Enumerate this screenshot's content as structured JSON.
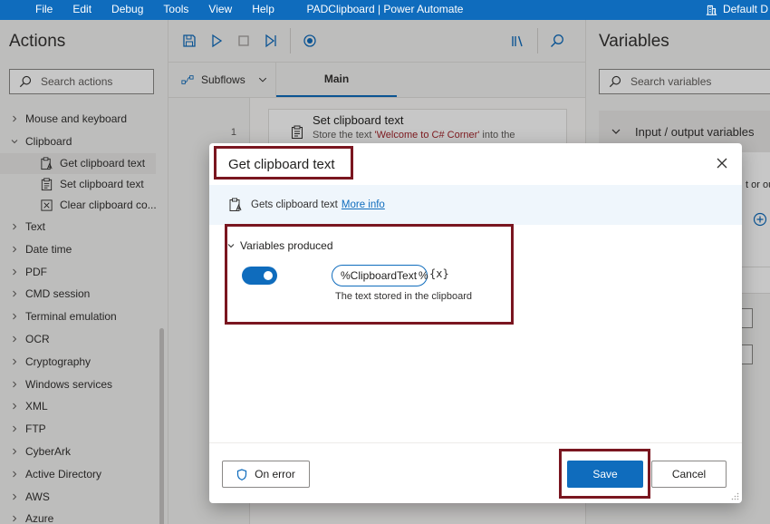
{
  "window": {
    "title": "PADClipboard | Power Automate",
    "menu": [
      "File",
      "Edit",
      "Debug",
      "Tools",
      "View",
      "Help"
    ],
    "profile": "Default D"
  },
  "actions_pane": {
    "title": "Actions",
    "search_placeholder": "Search actions",
    "groups": [
      {
        "label": "Mouse and keyboard",
        "expanded": false
      },
      {
        "label": "Clipboard",
        "expanded": true,
        "children": [
          "Get clipboard text",
          "Set clipboard text",
          "Clear clipboard co..."
        ]
      },
      {
        "label": "Text",
        "expanded": false
      },
      {
        "label": "Date time",
        "expanded": false
      },
      {
        "label": "PDF",
        "expanded": false
      },
      {
        "label": "CMD session",
        "expanded": false
      },
      {
        "label": "Terminal emulation",
        "expanded": false
      },
      {
        "label": "OCR",
        "expanded": false
      },
      {
        "label": "Cryptography",
        "expanded": false
      },
      {
        "label": "Windows services",
        "expanded": false
      },
      {
        "label": "XML",
        "expanded": false
      },
      {
        "label": "FTP",
        "expanded": false
      },
      {
        "label": "CyberArk",
        "expanded": false
      },
      {
        "label": "Active Directory",
        "expanded": false
      },
      {
        "label": "AWS",
        "expanded": false
      },
      {
        "label": "Azure",
        "expanded": false
      }
    ]
  },
  "designer": {
    "subflows_label": "Subflows",
    "main_tab": "Main",
    "steps": [
      {
        "number": "1",
        "title": "Set clipboard text",
        "desc_prefix": "Store the text ",
        "desc_value": "'Welcome to C# Corner'",
        "desc_suffix": " into the"
      }
    ]
  },
  "variables_pane": {
    "title": "Variables",
    "search_placeholder": "Search variables",
    "io_section": "Input / output variables",
    "io_text": "t or ou"
  },
  "dialog": {
    "title": "Get clipboard text",
    "info_text": "Gets clipboard text",
    "info_link": "More info",
    "variables_header": "Variables produced",
    "variable_name": "%ClipboardText%",
    "variable_name_before_caret": "%ClipboardText",
    "variable_name_after_caret": "%",
    "variable_fx": "{x}",
    "variable_description": "The text stored in the clipboard",
    "toggle_on": true,
    "on_error_label": "On error",
    "save_label": "Save",
    "cancel_label": "Cancel"
  },
  "colors": {
    "accent": "#0f6cbd",
    "highlight_box": "#7a1620",
    "link": "#0f6cbd",
    "string_literal": "#a4262c"
  }
}
